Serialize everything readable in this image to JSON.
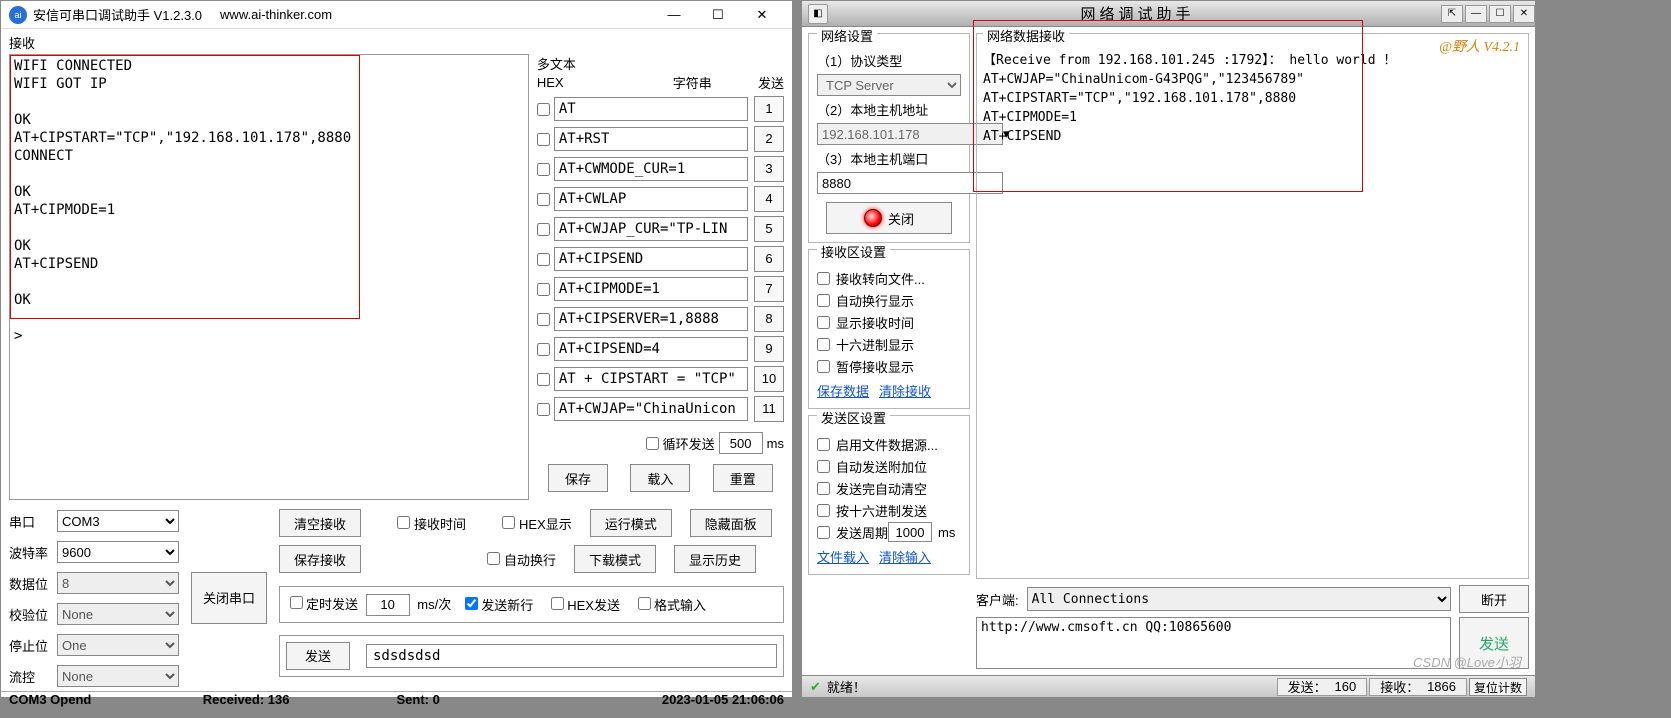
{
  "left": {
    "title_app": "安信可串口调试助手 V1.2.3.0",
    "title_url": "www.ai-thinker.com",
    "icon_text": "ai",
    "min_glyph": "—",
    "max_glyph": "☐",
    "close_glyph": "✕",
    "recv_label": "接收",
    "recv_text": "WIFI CONNECTED\nWIFI GOT IP\n\nOK\nAT+CIPSTART=\"TCP\",\"192.168.101.178\",8880\nCONNECT\n\nOK\nAT+CIPMODE=1\n\nOK\nAT+CIPSEND\n\nOK\n\n>",
    "multi": {
      "title": "多文本",
      "hex_label": "HEX",
      "str_label": "字符串",
      "send_label": "发送",
      "rows": [
        {
          "cmd": "AT",
          "idx": "1"
        },
        {
          "cmd": "AT+RST",
          "idx": "2"
        },
        {
          "cmd": "AT+CWMODE_CUR=1",
          "idx": "3"
        },
        {
          "cmd": "AT+CWLAP",
          "idx": "4"
        },
        {
          "cmd": "AT+CWJAP_CUR=\"TP-LIN",
          "idx": "5"
        },
        {
          "cmd": "AT+CIPSEND",
          "idx": "6"
        },
        {
          "cmd": "AT+CIPMODE=1",
          "idx": "7"
        },
        {
          "cmd": "AT+CIPSERVER=1,8888",
          "idx": "8"
        },
        {
          "cmd": "AT+CIPSEND=4",
          "idx": "9"
        },
        {
          "cmd": "AT + CIPSTART = \"TCP\" , \"",
          "idx": "10"
        },
        {
          "cmd": "AT+CWJAP=\"ChinaUnicon",
          "idx": "11"
        }
      ],
      "loop_label": "循环发送",
      "loop_value": "500",
      "loop_unit": "ms",
      "save_btn": "保存",
      "load_btn": "载入",
      "reset_btn": "重置"
    },
    "serial": {
      "port_label": "串口",
      "port_value": "COM3",
      "baud_label": "波特率",
      "baud_value": "9600",
      "data_label": "数据位",
      "data_value": "8",
      "check_label": "校验位",
      "check_value": "None",
      "stop_label": "停止位",
      "stop_value": "One",
      "flow_label": "流控",
      "flow_value": "None",
      "close_btn": "关闭串口"
    },
    "mid": {
      "clear_recv": "清空接收",
      "save_recv": "保存接收",
      "recv_time": "接收时间",
      "hex_show": "HEX显示",
      "run_mode": "运行模式",
      "hide_panel": "隐藏面板",
      "auto_wrap": "自动换行",
      "dl_mode": "下载模式",
      "show_hist": "显示历史"
    },
    "send": {
      "timed_send": "定时发送",
      "interval": "10",
      "interval_unit": "ms/次",
      "send_newline": "发送新行",
      "hex_send": "HEX发送",
      "format_input": "格式输入",
      "send_btn": "发送",
      "send_text": "sdsdsdsd"
    },
    "status": {
      "port": "COM3 Opend",
      "received": "Received: 136",
      "sent": "Sent: 0",
      "time": "2023-01-05 21:06:06"
    }
  },
  "right": {
    "title": "网络调试助手",
    "brand": "@野人  V4.2.1",
    "watermark": "CSDN @Love小羽",
    "net_settings": {
      "legend": "网络设置",
      "proto_label": "（1）协议类型",
      "proto_value": "TCP Server",
      "host_label": "（2）本地主机地址",
      "host_value": "192.168.101.178",
      "port_label": "（3）本地主机端口",
      "port_value": "8880",
      "close_btn": "关闭"
    },
    "recv_opts": {
      "legend": "接收区设置",
      "o1": "接收转向文件...",
      "o2": "自动换行显示",
      "o3": "显示接收时间",
      "o4": "十六进制显示",
      "o5": "暂停接收显示",
      "link_save": "保存数据",
      "link_clear": "清除接收"
    },
    "send_opts": {
      "legend": "发送区设置",
      "o1": "启用文件数据源...",
      "o2": "自动发送附加位",
      "o3": "发送完自动清空",
      "o4": "按十六进制发送",
      "o5": "发送周期",
      "period_value": "1000",
      "period_unit": "ms",
      "link_load": "文件载入",
      "link_clear": "清除输入"
    },
    "net_recv": {
      "legend": "网络数据接收",
      "text": "【Receive from 192.168.101.245 :1792】： hello world ！\nAT+CWJAP=\"ChinaUnicom-G43PQG\",\"123456789\"\nAT+CIPSTART=\"TCP\",\"192.168.101.178\",8880\nAT+CIPMODE=1\nAT+CIPSEND"
    },
    "client_label": "客户端:",
    "client_value": "All Connections",
    "disconnect_btn": "断开",
    "send_text": "http://www.cmsoft.cn QQ:10865600",
    "send_btn": "发送",
    "status": {
      "ready_icon": "✔",
      "ready": "就绪！",
      "sent_label": "发送：",
      "sent_value": "160",
      "recv_label": "接收：",
      "recv_value": "1866",
      "reset_btn": "复位计数"
    }
  }
}
